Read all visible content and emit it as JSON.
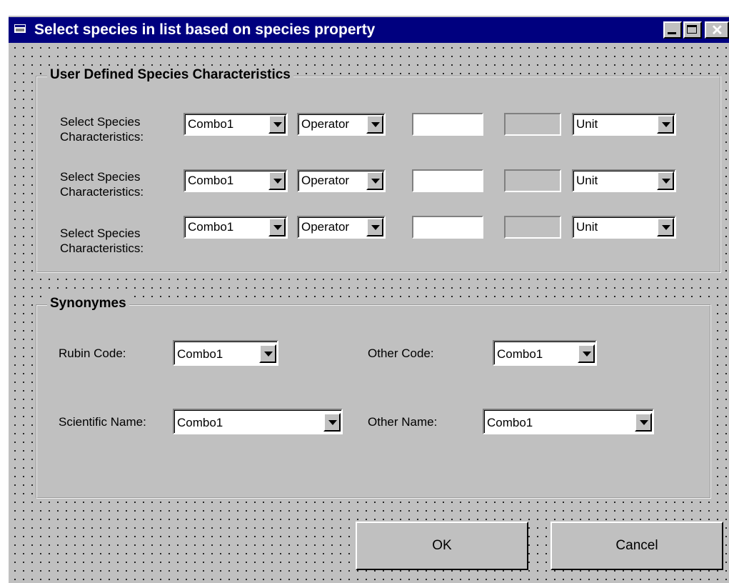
{
  "window": {
    "title": "Select species in list based on species property"
  },
  "characteristics": {
    "legend": "User Defined Species Characteristics",
    "rows": [
      {
        "label": "Select Species\nCharacteristics:",
        "combo": "Combo1",
        "operator": "Operator",
        "value": "",
        "unit": "Unit"
      },
      {
        "label": "Select Species\nCharacteristics:",
        "combo": "Combo1",
        "operator": "Operator",
        "value": "",
        "unit": "Unit"
      },
      {
        "label": "Select Species\nCharacteristics:",
        "combo": "Combo1",
        "operator": "Operator",
        "value": "",
        "unit": "Unit"
      }
    ]
  },
  "synonymes": {
    "legend": "Synonymes",
    "rubin_code": {
      "label": "Rubin Code:",
      "value": "Combo1"
    },
    "other_code": {
      "label": "Other Code:",
      "value": "Combo1"
    },
    "scientific_name": {
      "label": "Scientific Name:",
      "value": "Combo1"
    },
    "other_name": {
      "label": "Other Name:",
      "value": "Combo1"
    }
  },
  "buttons": {
    "ok": "OK",
    "cancel": "Cancel"
  }
}
